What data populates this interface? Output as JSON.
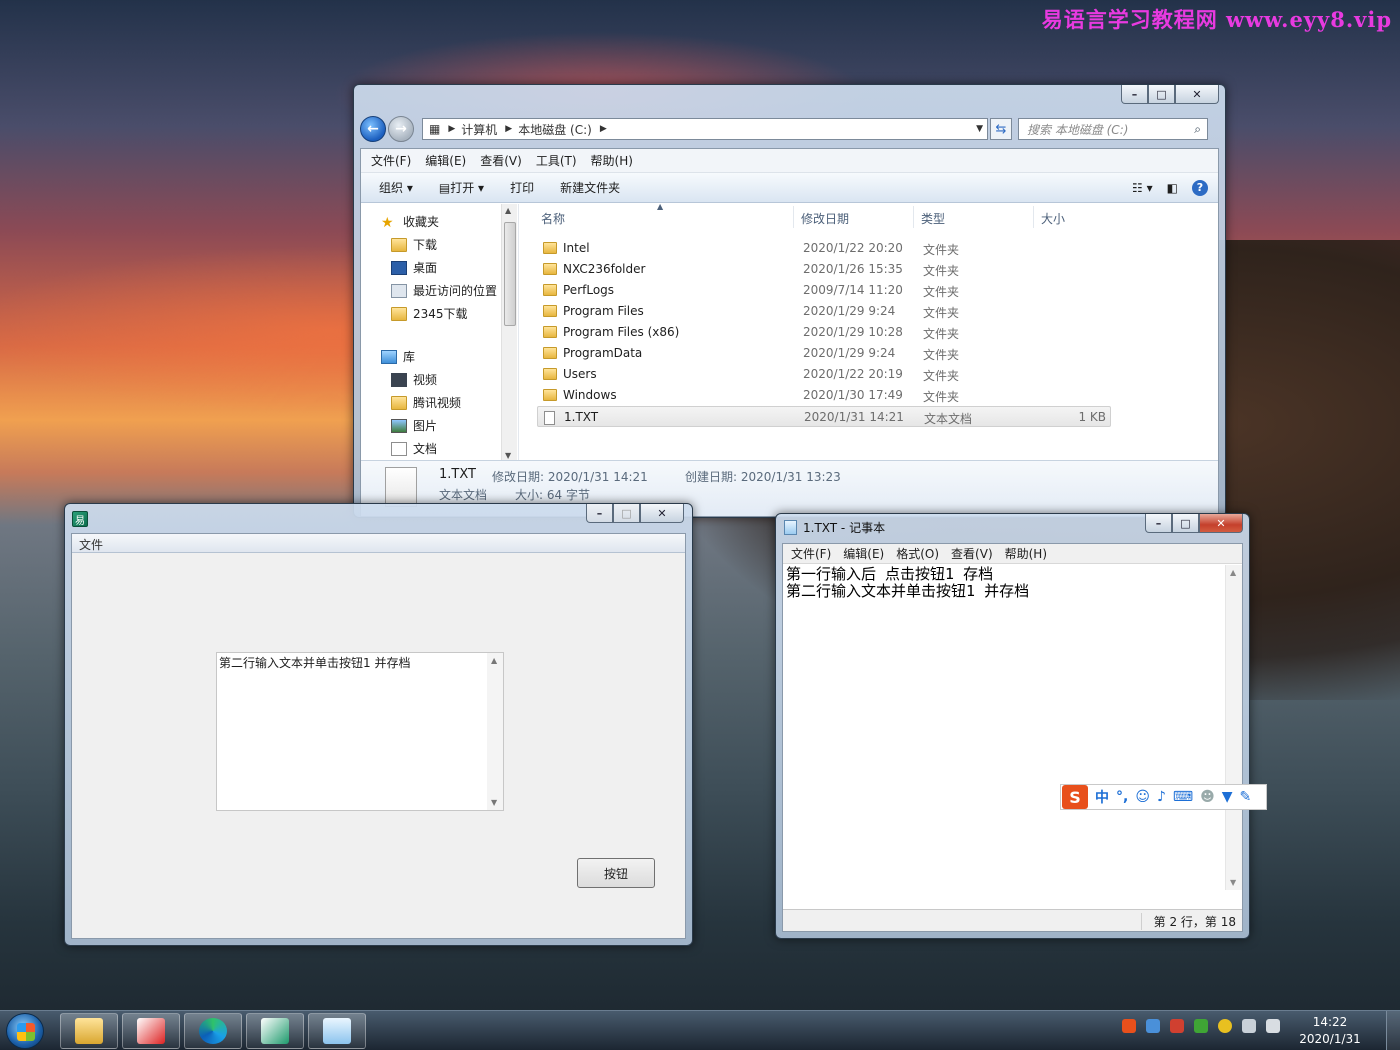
{
  "desktop": {
    "watermark": "易语言学习教程网 www.eyy8.vip"
  },
  "explorer": {
    "breadcrumb": [
      "计算机",
      "本地磁盘 (C:)"
    ],
    "search_placeholder": "搜索 本地磁盘 (C:)",
    "menu": [
      "文件(F)",
      "编辑(E)",
      "查看(V)",
      "工具(T)",
      "帮助(H)"
    ],
    "toolbar": {
      "organize": "组织",
      "open": "打开",
      "print": "打印",
      "new_folder": "新建文件夹"
    },
    "nav": {
      "favorites": "收藏夹",
      "fav_items": [
        "下载",
        "桌面",
        "最近访问的位置",
        "2345下载"
      ],
      "library": "库",
      "lib_items": [
        "视频",
        "腾讯视频",
        "图片",
        "文档"
      ]
    },
    "columns": {
      "name": "名称",
      "date": "修改日期",
      "type": "类型",
      "size": "大小"
    },
    "files": [
      {
        "name": "Intel",
        "date": "2020/1/22 20:20",
        "type": "文件夹",
        "size": ""
      },
      {
        "name": "NXC236folder",
        "date": "2020/1/26 15:35",
        "type": "文件夹",
        "size": ""
      },
      {
        "name": "PerfLogs",
        "date": "2009/7/14 11:20",
        "type": "文件夹",
        "size": ""
      },
      {
        "name": "Program Files",
        "date": "2020/1/29 9:24",
        "type": "文件夹",
        "size": ""
      },
      {
        "name": "Program Files (x86)",
        "date": "2020/1/29 10:28",
        "type": "文件夹",
        "size": ""
      },
      {
        "name": "ProgramData",
        "date": "2020/1/29 9:24",
        "type": "文件夹",
        "size": ""
      },
      {
        "name": "Users",
        "date": "2020/1/22 20:19",
        "type": "文件夹",
        "size": ""
      },
      {
        "name": "Windows",
        "date": "2020/1/30 17:49",
        "type": "文件夹",
        "size": ""
      },
      {
        "name": "1.TXT",
        "date": "2020/1/31 14:21",
        "type": "文本文档",
        "size": "1 KB"
      }
    ],
    "details": {
      "filename": "1.TXT",
      "modified": "修改日期: 2020/1/31 14:21",
      "created": "创建日期: 2020/1/31 13:23",
      "filetype": "文本文档",
      "size": "大小: 64 字节"
    }
  },
  "app": {
    "menu": "文件",
    "memo_text": "第二行输入文本并单击按钮1 并存档",
    "button": "按钮"
  },
  "notepad": {
    "title": "1.TXT - 记事本",
    "menu": [
      "文件(F)",
      "编辑(E)",
      "格式(O)",
      "查看(V)",
      "帮助(H)"
    ],
    "lines": [
      "第一行输入后  点击按钮1 存档",
      "第二行输入文本并单击按钮1 并存档"
    ],
    "status": "第 2 行，第 18"
  },
  "ime": {
    "mode": "中",
    "punct": "°,"
  },
  "taskbar": {
    "time": "14:22",
    "date": "2020/1/31"
  }
}
